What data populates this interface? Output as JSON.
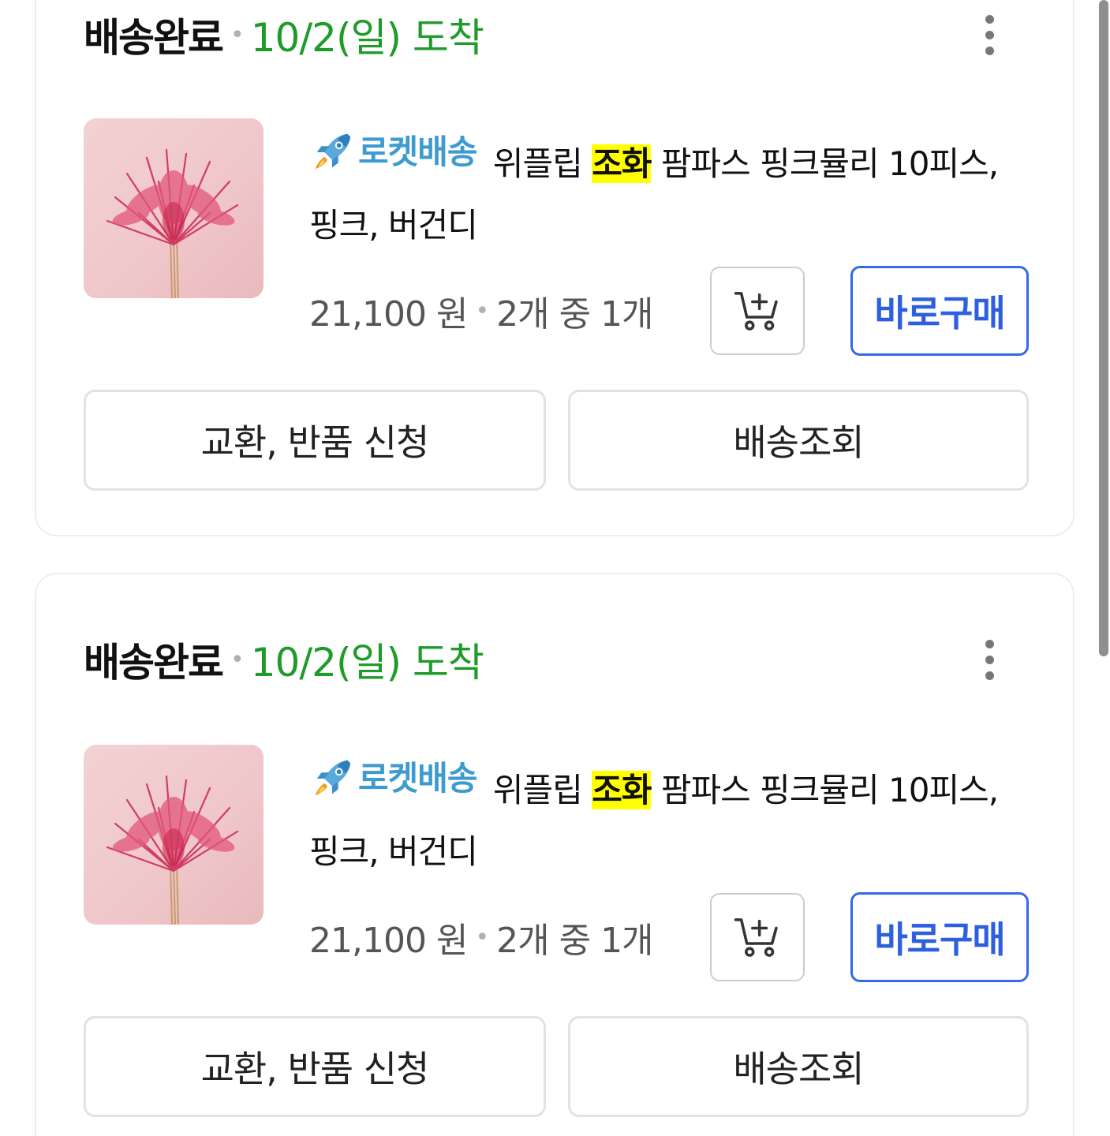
{
  "orders": [
    {
      "status": "배송완료",
      "arrival": "10/2(일) 도착",
      "product": {
        "image_icon": "pink-pampas-grass-photo",
        "badge": "로켓배송",
        "title_before": "위플립",
        "title_highlight": "조화",
        "title_after": "팜파스 핑크뮬리 10피스, 핑크, 버건디"
      },
      "price": "21,100 원",
      "quantity": "2개 중 1개",
      "cart_icon": "add-to-cart-icon",
      "buy_now_label": "바로구매",
      "exchange_return_label": "교환, 반품 신청",
      "track_shipping_label": "배송조회"
    },
    {
      "status": "배송완료",
      "arrival": "10/2(일) 도착",
      "product": {
        "image_icon": "pink-pampas-grass-photo",
        "badge": "로켓배송",
        "title_before": "위플립",
        "title_highlight": "조화",
        "title_after": "팜파스 핑크뮬리 10피스, 핑크, 버건디"
      },
      "price": "21,100 원",
      "quantity": "2개 중 1개",
      "cart_icon": "add-to-cart-icon",
      "buy_now_label": "바로구매",
      "exchange_return_label": "교환, 반품 신청",
      "track_shipping_label": "배송조회"
    }
  ],
  "colors": {
    "arrival_green": "#1f9b2a",
    "rocket_blue": "#3d9bd0",
    "buy_button_blue": "#2e5fe0",
    "highlight_yellow": "#ffff00"
  }
}
